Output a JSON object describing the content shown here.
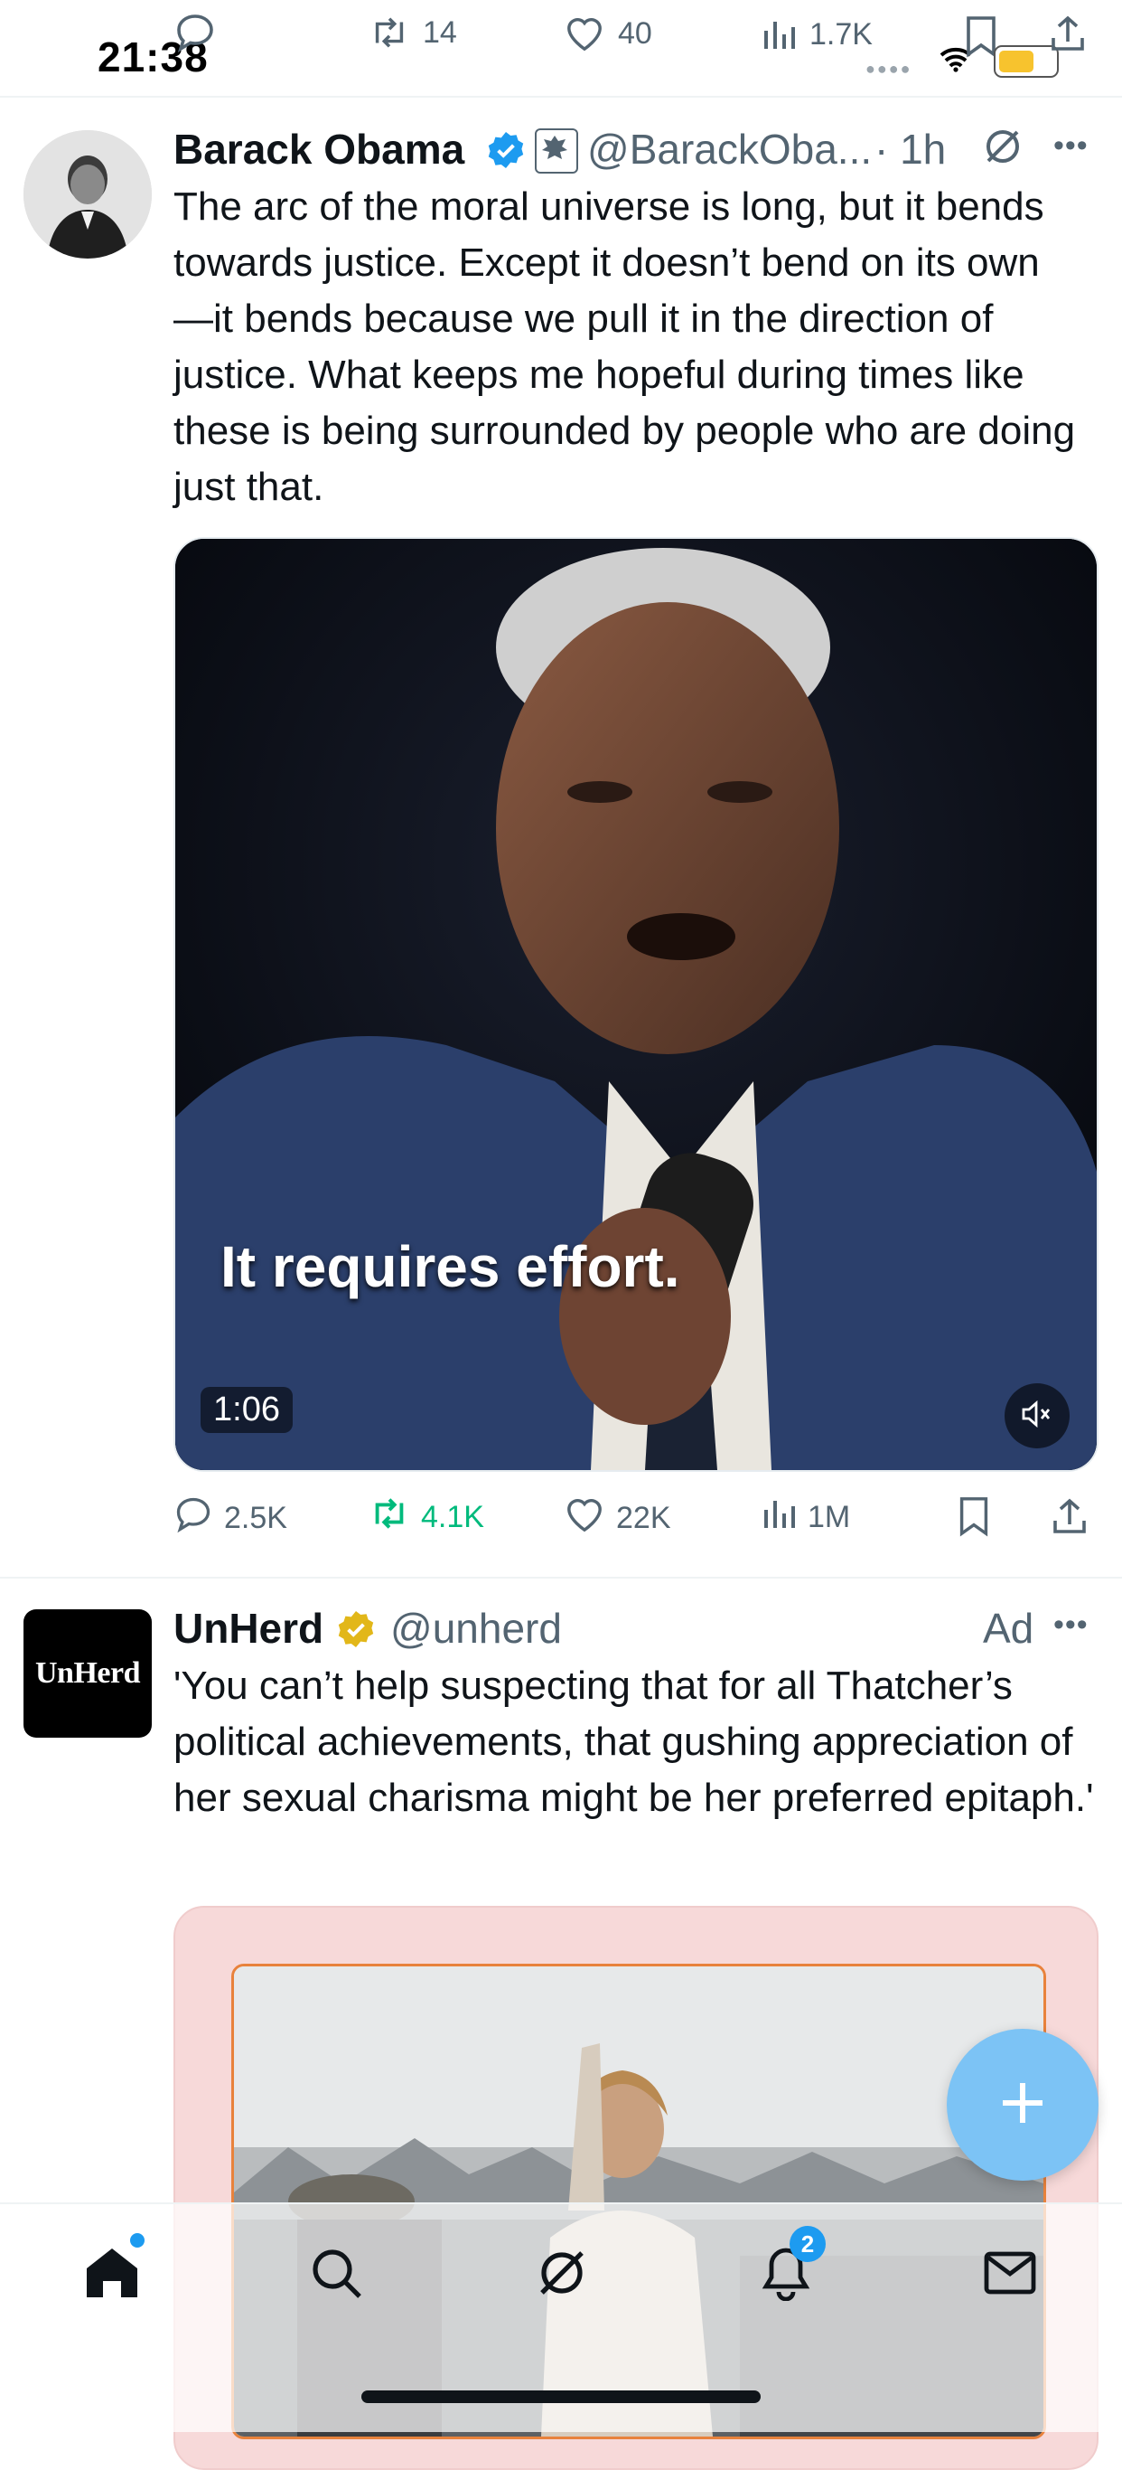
{
  "status_bar": {
    "time": "21:38"
  },
  "prev_tweet_actions": {
    "retweets": "14",
    "likes": "40",
    "views": "1.7K"
  },
  "tweet1": {
    "name": "Barack Obama",
    "handle": "@BarackOba...",
    "time": "· 1h",
    "text": "The arc of the moral universe is long, but it bends towards justice. Except it doesn’t bend on its own—it bends because we pull it in the direction of justice. What keeps me hopeful during times like these is being surrounded by people who are doing just that.",
    "video": {
      "caption": "It requires effort.",
      "duration": "1:06"
    },
    "actions": {
      "replies": "2.5K",
      "retweets": "4.1K",
      "likes": "22K",
      "views": "1M"
    }
  },
  "tweet2": {
    "name": "UnHerd",
    "handle": "@unherd",
    "ad_label": "Ad",
    "avatar_text": "UnHerd",
    "text": "'You can’t help suspecting that for all Thatcher’s political achievements, that gushing appreciation of her sexual charisma might be her preferred epitaph.'"
  },
  "tabbar": {
    "notifications_count": "2"
  },
  "colors": {
    "verified_blue": "#1d9bf0",
    "verified_gold": "#e2b719",
    "retweet_green": "#00ba7c",
    "fab_blue": "#7cc3f5",
    "secondary_text": "#536471"
  }
}
